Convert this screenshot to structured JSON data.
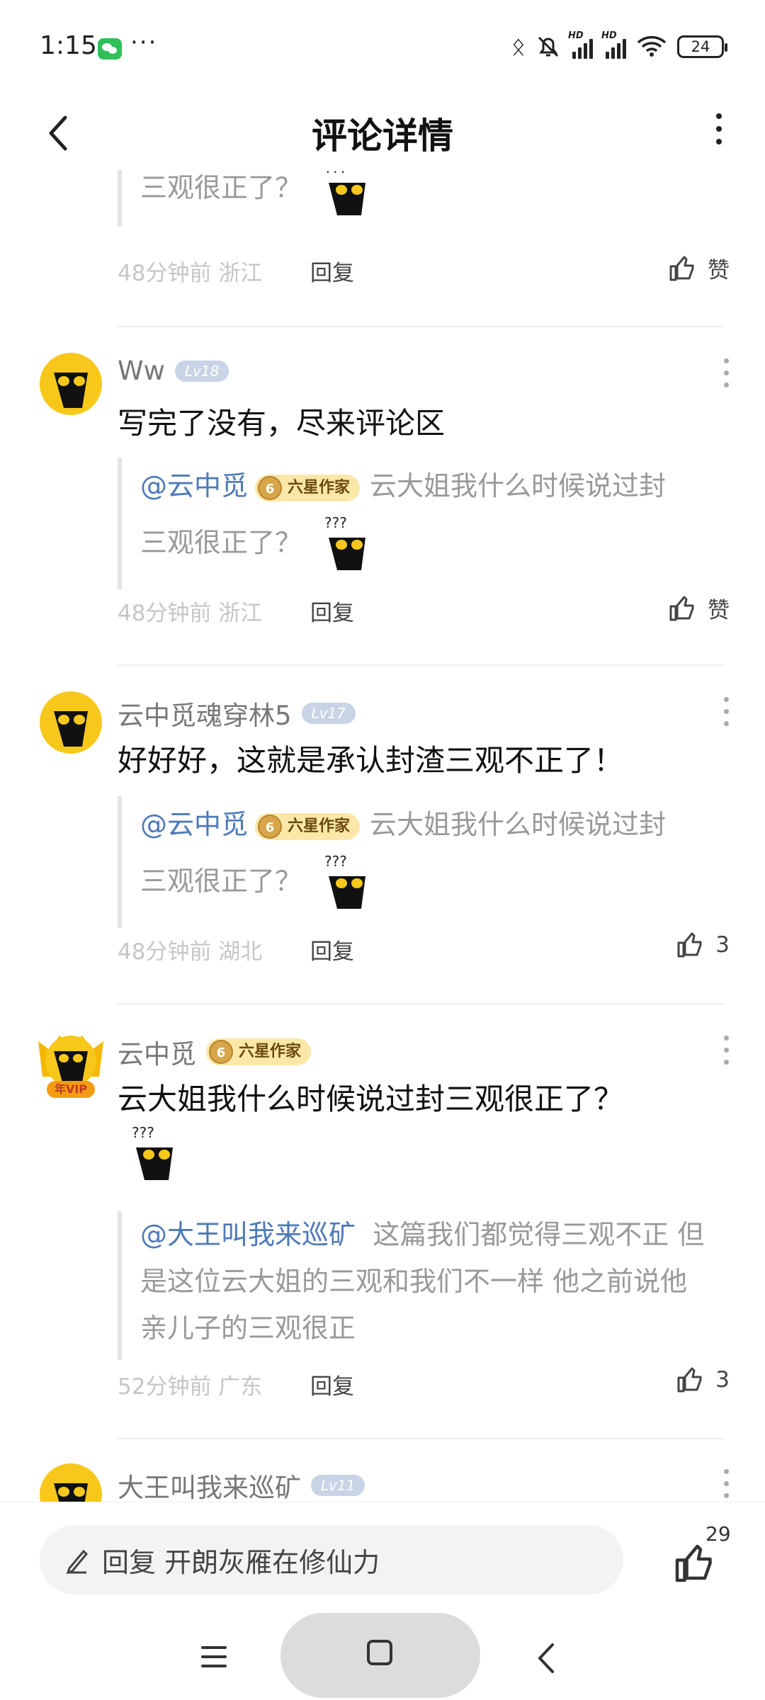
{
  "status": {
    "time": "1:15",
    "more": "···",
    "battery": "24"
  },
  "header": {
    "title": "评论详情"
  },
  "top_comment": {
    "quote": "三观很正了？",
    "time": "48分钟前 浙江",
    "reply": "回复",
    "like": "赞"
  },
  "comments": [
    {
      "user": "Ww",
      "level": "Lv18",
      "text": "写完了没有，尽来评论区",
      "quote_user": "@云中觅",
      "quote_badge": "六星作家",
      "quote_line1": "云大姐我什么时候说过封",
      "quote_line2": "三观很正了？",
      "time": "48分钟前 浙江",
      "reply": "回复",
      "like": "赞"
    },
    {
      "user": "云中觅魂穿林5",
      "level": "Lv17",
      "text": "好好好，这就是承认封渣三观不正了！",
      "quote_user": "@云中觅",
      "quote_badge": "六星作家",
      "quote_line1": "云大姐我什么时候说过封",
      "quote_line2": "三观很正了？",
      "time": "48分钟前 湖北",
      "reply": "回复",
      "like": "3"
    },
    {
      "user": "云中觅",
      "badge": "六星作家",
      "vip": "年VIP",
      "text": "云大姐我什么时候说过封三观很正了？",
      "quote_user": "@大王叫我来巡矿",
      "quote_line1": "这篇我们都觉得三观不正 但",
      "quote_line2": "是这位云大姐的三观和我们不一样 他之前说他",
      "quote_line3": "亲儿子的三观很正",
      "time": "52分钟前 广东",
      "reply": "回复",
      "like": "3"
    },
    {
      "user": "大王叫我来巡矿",
      "level": "Lv11"
    }
  ],
  "bottom": {
    "reply_placeholder": "回复 开朗灰雁在修仙力",
    "like_count": "29"
  }
}
